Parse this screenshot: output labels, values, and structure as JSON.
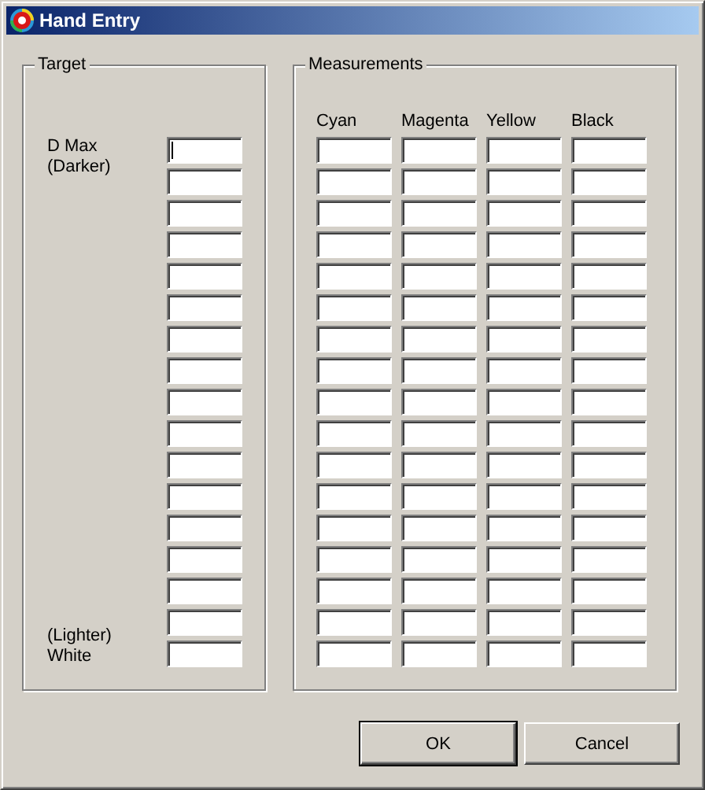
{
  "window": {
    "title": "Hand Entry"
  },
  "target": {
    "title": "Target",
    "top_label": "D Max (Darker)",
    "bottom_label": "(Lighter) White",
    "fields": [
      {
        "focused": true
      },
      {
        "focused": false
      },
      {
        "focused": false
      },
      {
        "focused": false
      },
      {
        "focused": false
      },
      {
        "focused": false
      },
      {
        "focused": false
      },
      {
        "focused": false
      },
      {
        "focused": false
      },
      {
        "focused": false
      },
      {
        "focused": false
      },
      {
        "focused": false
      },
      {
        "focused": false
      },
      {
        "focused": false
      },
      {
        "focused": false
      },
      {
        "focused": false
      },
      {
        "focused": false
      }
    ]
  },
  "measurements": {
    "title": "Measurements",
    "columns": [
      "Cyan",
      "Magenta",
      "Yellow",
      "Black"
    ],
    "rows": [
      {
        "focused": [
          false,
          false,
          false,
          false
        ]
      },
      {
        "focused": [
          false,
          false,
          false,
          false
        ]
      },
      {
        "focused": [
          false,
          false,
          false,
          false
        ]
      },
      {
        "focused": [
          false,
          false,
          false,
          false
        ]
      },
      {
        "focused": [
          false,
          false,
          false,
          false
        ]
      },
      {
        "focused": [
          false,
          false,
          false,
          false
        ]
      },
      {
        "focused": [
          false,
          false,
          false,
          false
        ]
      },
      {
        "focused": [
          false,
          false,
          false,
          false
        ]
      },
      {
        "focused": [
          false,
          false,
          false,
          false
        ]
      },
      {
        "focused": [
          false,
          false,
          false,
          false
        ]
      },
      {
        "focused": [
          false,
          false,
          false,
          false
        ]
      },
      {
        "focused": [
          false,
          false,
          false,
          false
        ]
      },
      {
        "focused": [
          false,
          false,
          false,
          false
        ]
      },
      {
        "focused": [
          false,
          false,
          false,
          false
        ]
      },
      {
        "focused": [
          false,
          false,
          false,
          false
        ]
      },
      {
        "focused": [
          false,
          false,
          false,
          false
        ]
      },
      {
        "focused": [
          false,
          false,
          false,
          false
        ]
      }
    ]
  },
  "buttons": [
    {
      "label": "OK",
      "default": true
    },
    {
      "label": "Cancel",
      "default": false
    }
  ]
}
